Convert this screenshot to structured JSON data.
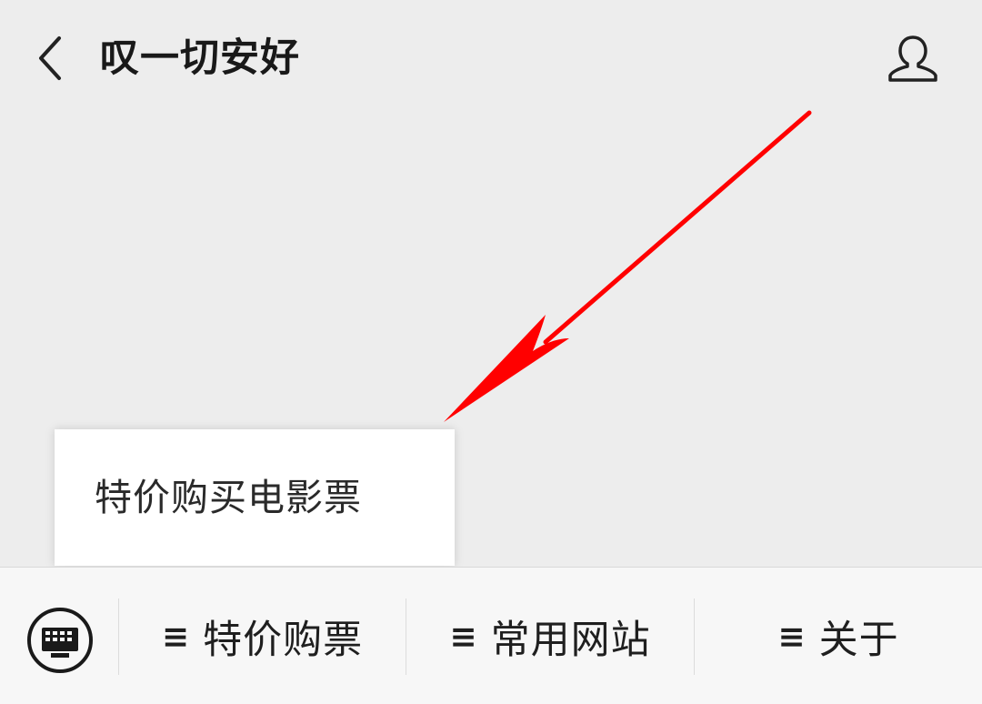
{
  "header": {
    "title": "叹一切安好",
    "back_icon": "chevron-left-icon",
    "profile_icon": "user-icon"
  },
  "popup": {
    "items": [
      {
        "label": "特价购买电影票"
      }
    ]
  },
  "bottom_bar": {
    "keyboard_icon": "keyboard-icon",
    "menus": [
      {
        "icon": "≡",
        "label": "特价购票"
      },
      {
        "icon": "≡",
        "label": "常用网站"
      },
      {
        "icon": "≡",
        "label": "关于"
      }
    ]
  },
  "annotation": {
    "arrow_color": "#ff0000"
  }
}
